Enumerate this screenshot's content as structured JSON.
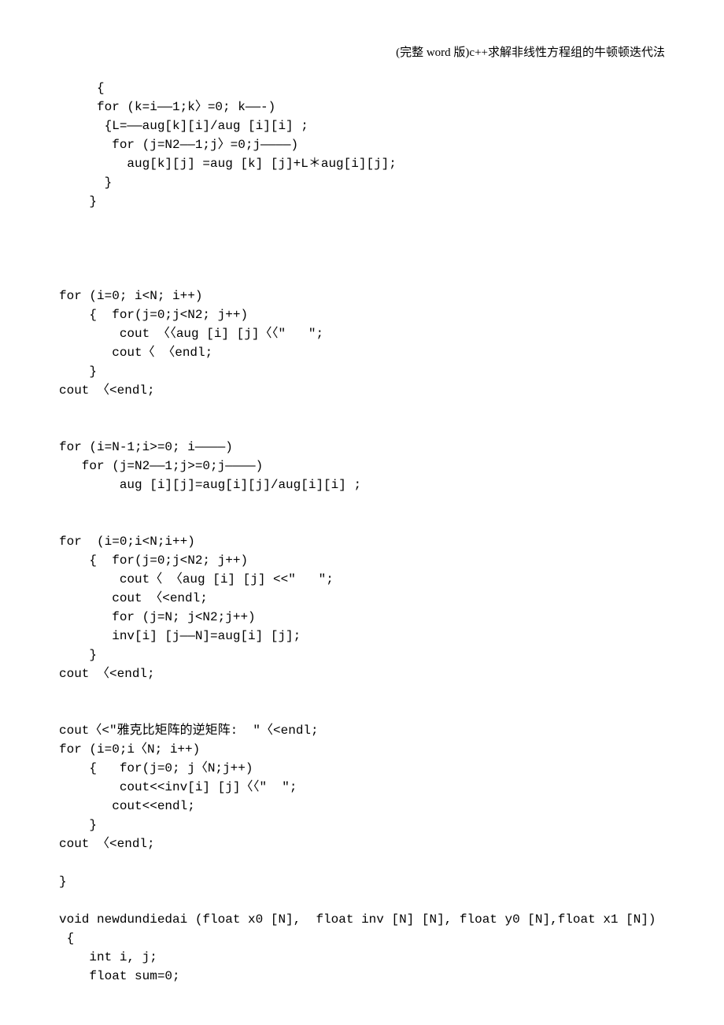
{
  "header": "(完整 word 版)c++求解非线性方程组的牛顿顿迭代法",
  "code": {
    "l1": "     {",
    "l2": "     for (k=i——1;k〉=0; k——-)",
    "l3": "      {L=——aug[k][i]/aug [i][i] ;",
    "l4": "       for (j=N2——1;j〉=0;j————)",
    "l5": "         aug[k][j] =aug [k] [j]+L＊aug[i][j];",
    "l6": "      }",
    "l7": "    }",
    "l8": "",
    "l9": "",
    "l10": "",
    "l11": "",
    "l12": "for (i=0; i<N; i++)",
    "l13": "    {  for(j=0;j<N2; j++)",
    "l14": "        cout 〈〈aug [i] [j]〈〈\"   \";",
    "l15": "       cout〈 〈endl;",
    "l16": "    }",
    "l17": "cout 〈<endl;",
    "l18": "",
    "l19": "",
    "l20": "for (i=N-1;i>=0; i————)",
    "l21": "   for (j=N2——1;j>=0;j————)",
    "l22": "        aug [i][j]=aug[i][j]/aug[i][i] ;",
    "l23": "",
    "l24": "",
    "l25": "for  (i=0;i<N;i++)",
    "l26": "    {  for(j=0;j<N2; j++)",
    "l27": "        cout〈 〈aug [i] [j] <<\"   \";",
    "l28": "       cout 〈<endl;",
    "l29": "       for (j=N; j<N2;j++)",
    "l30": "       inv[i] [j——N]=aug[i] [j];",
    "l31": "    }",
    "l32": "cout 〈<endl;",
    "l33": "",
    "l34": "",
    "l35": "cout〈<\"雅克比矩阵的逆矩阵:  \"〈<endl;",
    "l36": "for (i=0;i〈N; i++)",
    "l37": "    {   for(j=0; j〈N;j++)",
    "l38": "        cout<<inv[i] [j]〈〈\"  \";",
    "l39": "       cout<<endl;",
    "l40": "    }",
    "l41": "cout 〈<endl;",
    "l42": "",
    "l43": "}",
    "l44": "",
    "l45": "void newdundiedai (float x0 [N],  float inv [N] [N], float y0 [N],float x1 [N])",
    "l46": " {",
    "l47": "    int i, j;",
    "l48": "    float sum=0;"
  }
}
